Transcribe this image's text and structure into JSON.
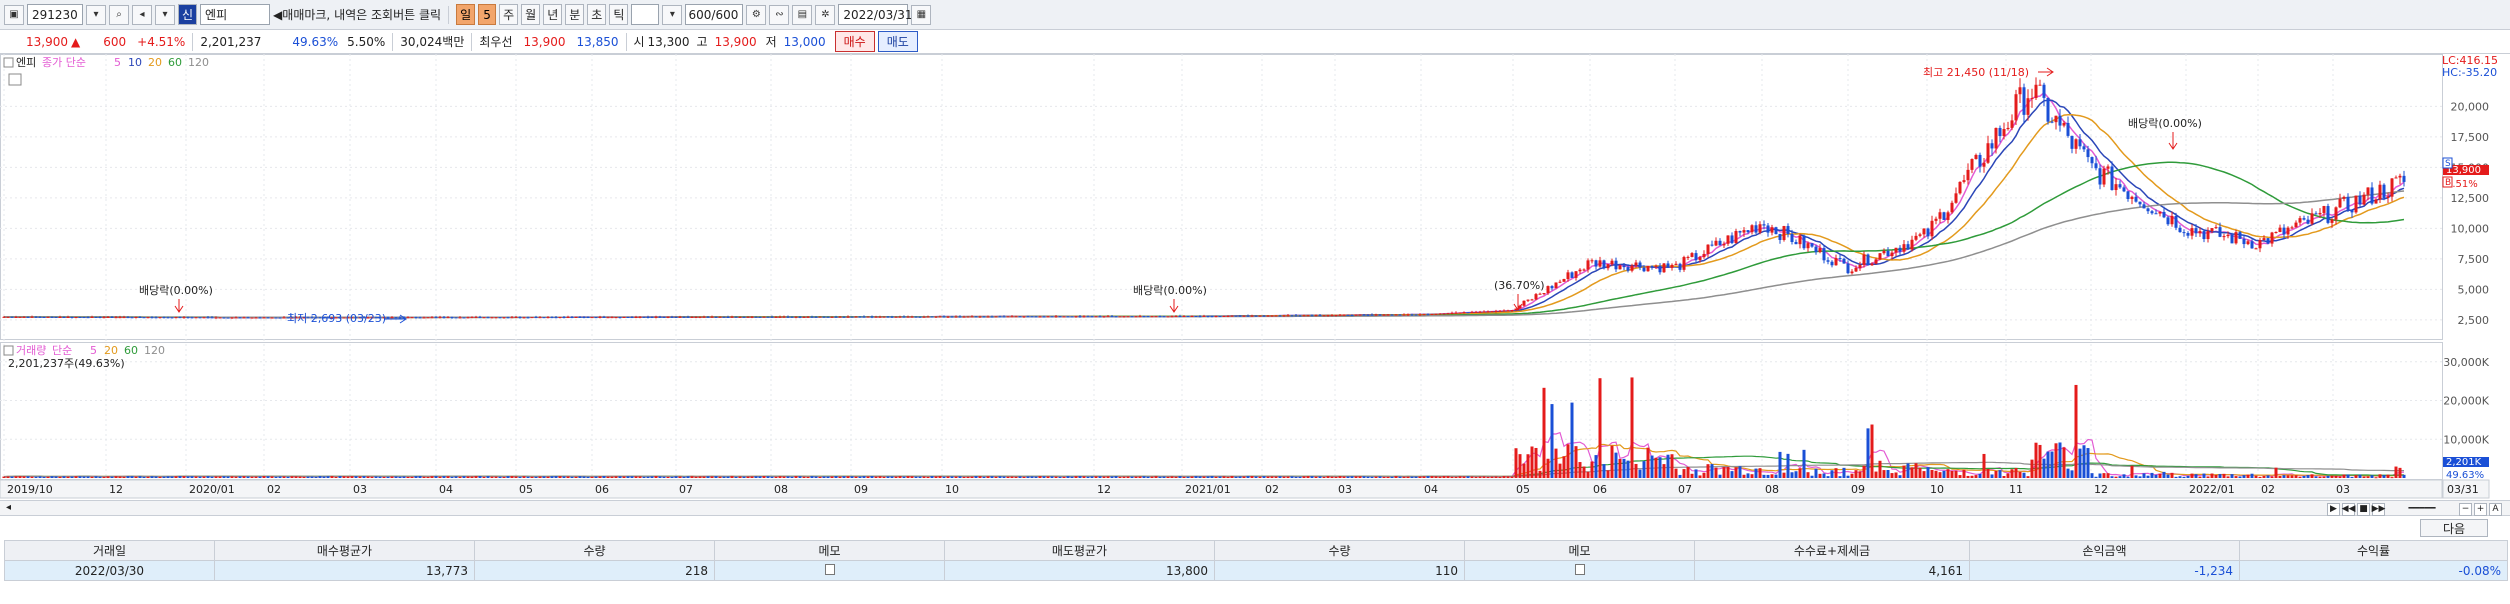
{
  "toolbar": {
    "code": "291230",
    "badge": "신",
    "name": "엔피",
    "hint": "◀매매마크, 내역은 조회버튼 클릭",
    "periods": [
      "일",
      "5",
      "주",
      "월",
      "년",
      "분",
      "초",
      "틱"
    ],
    "period_active": "일",
    "count": "600/600",
    "date": "2022/03/31"
  },
  "quote": {
    "price": "13,900",
    "change_arrow": "▲",
    "change": "600",
    "change_pct": "+4.51%",
    "volume": "2,201,237",
    "vol_ratio": "49.63%",
    "turnover": "5.50%",
    "trade_value": "30,024백만",
    "best_label": "최우선",
    "ask": "13,900",
    "bid": "13,850",
    "open_label": "시",
    "open": "13,300",
    "high_label": "고",
    "high": "13,900",
    "low_label": "저",
    "low": "13,000",
    "buy_btn": "매수",
    "sell_btn": "매도"
  },
  "price_panel": {
    "name": "엔피",
    "ma_label": "종가 단순",
    "ma_periods": [
      "5",
      "10",
      "20",
      "60",
      "120"
    ],
    "lc": "LC:416.15",
    "hc": "HC:-35.20",
    "price_tag": "13,900",
    "pct_tag": "4.51%",
    "ann_high": "최고 21,450 (11/18)",
    "ann_low": "최저 2,693 (03/23)",
    "ann_div1": "배당락(0.00%)",
    "ann_div2": "배당락(0.00%)",
    "ann_div3": "배당락(0.00%)",
    "ann_gap": "(36.70%)",
    "marker_s": "S",
    "marker_b": "B"
  },
  "volume_panel": {
    "label": "거래량",
    "ma_label": "단순",
    "ma_periods": [
      "5",
      "20",
      "60",
      "120"
    ],
    "info": "2,201,237주(49.63%)",
    "tag_vol": "2,201K",
    "tag_pct": "49.63%"
  },
  "date_tag": "03/31",
  "next_btn": "다음",
  "table": {
    "headers": [
      "거래일",
      "매수평균가",
      "수량",
      "메모",
      "매도평균가",
      "수량",
      "메모",
      "수수료+제세금",
      "손익금액",
      "수익률"
    ],
    "rows": [
      [
        "2022/03/30",
        "13,773",
        "218",
        "",
        "13,800",
        "110",
        "",
        "4,161",
        "-1,234",
        "-0.08%"
      ]
    ]
  },
  "colors": {
    "up": "#e41b1b",
    "down": "#1a4fd6",
    "ma5": "#e35bd3",
    "ma10": "#2b46b8",
    "ma20": "#e39a1d",
    "ma60": "#2f9b3a",
    "ma120": "#8f8f8f"
  },
  "chart_data": [
    {
      "type": "candlestick",
      "title": "엔피",
      "x_ticks": [
        "2019/10",
        "12",
        "2020/01",
        "02",
        "03",
        "04",
        "05",
        "06",
        "07",
        "08",
        "09",
        "10",
        "12",
        "2021/01",
        "02",
        "03",
        "04",
        "05",
        "06",
        "07",
        "08",
        "09",
        "10",
        "11",
        "12",
        "2022/01",
        "02",
        "03"
      ],
      "y_ticks": [
        2500,
        5000,
        7500,
        10000,
        12500,
        15000,
        17500,
        20000
      ],
      "ylim": [
        2000,
        22000
      ],
      "series": [
        {
          "name": "종가",
          "x": [
            "2019/10",
            "2020/03",
            "2021/01",
            "2021/04",
            "2021/05",
            "2021/06",
            "2021/07",
            "2021/08",
            "2021/09",
            "2021/10",
            "2021/11",
            "2021/12",
            "2022/01",
            "2022/02",
            "2022/03"
          ],
          "values": [
            2750,
            2693,
            2800,
            2950,
            3300,
            7200,
            6800,
            10500,
            6800,
            9500,
            21450,
            15000,
            10000,
            8800,
            13900
          ]
        }
      ]
    },
    {
      "type": "bar",
      "title": "거래량",
      "y_ticks": [
        10000,
        20000,
        30000
      ],
      "unit": "K",
      "ylim": [
        0,
        32000
      ],
      "series": [
        {
          "name": "거래량",
          "x": [
            "2021/05",
            "2021/06",
            "2021/07",
            "2021/08",
            "2021/09",
            "2021/10",
            "2021/11",
            "2021/12",
            "2022/01",
            "2022/02",
            "2022/03"
          ],
          "values": [
            29000,
            27000,
            12000,
            9000,
            14000,
            9000,
            31000,
            5000,
            4000,
            3000,
            2201
          ]
        }
      ]
    }
  ]
}
